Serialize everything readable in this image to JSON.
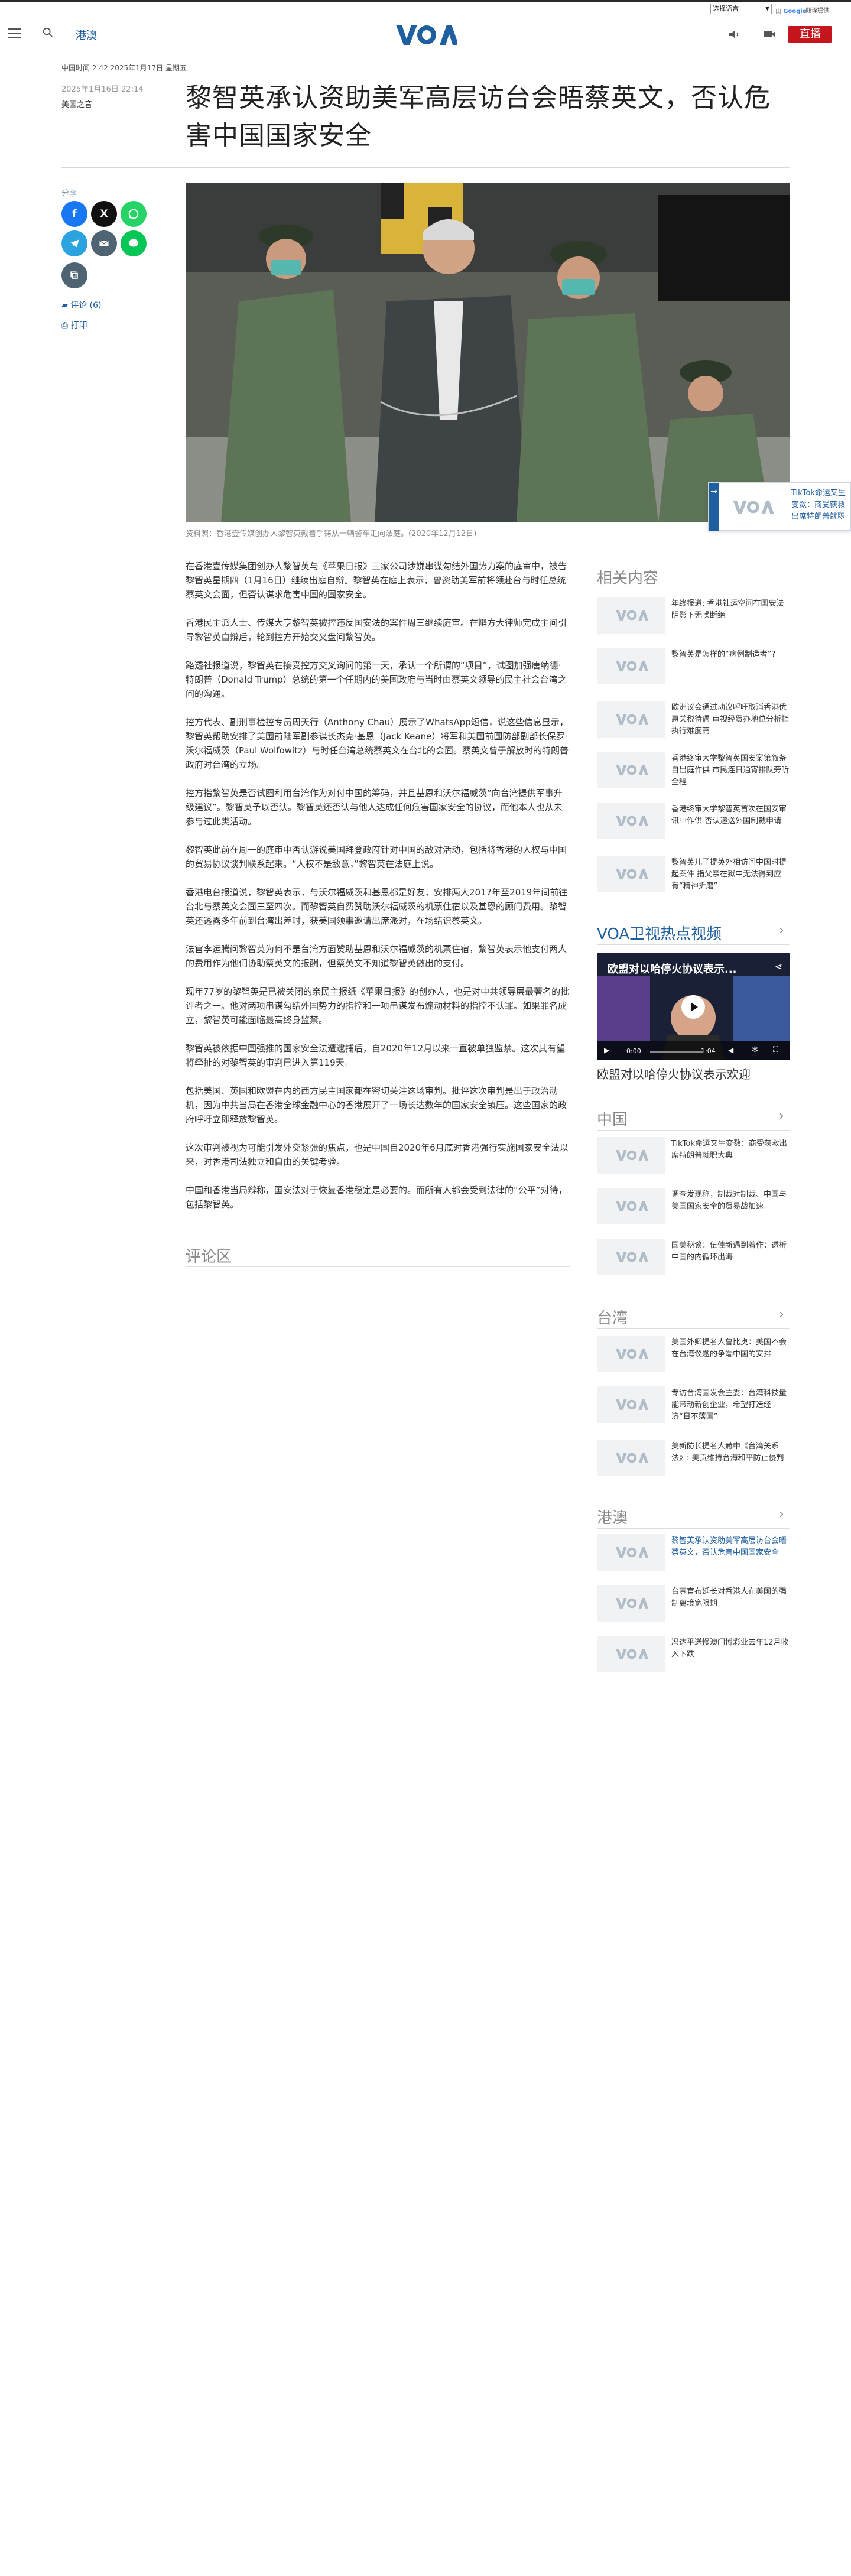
{
  "topbar": {
    "language_select": "选择语言",
    "google_badge": "Google",
    "translate_label": "翻译提供"
  },
  "header": {
    "section": "港澳",
    "live_label": "直播",
    "brand_color": "#1f5f9f",
    "live_color": "#c4161c"
  },
  "article": {
    "dateline": "中国时间 2:42 2025年1月17日 星期五",
    "date": "2025年1月16日 22:14",
    "author": "美国之音",
    "title": "黎智英承认资助美军高层访台会晤蔡英文，否认危害中国国家安全",
    "share_label": "分享",
    "comment_link": "评论 (6)",
    "print_link": "打印",
    "caption": "资料照：香港壹传媒创办人黎智英戴着手铐从一辆警车走向法庭。(2020年12月12日)",
    "paragraphs": [
      "在香港壹传媒集团创办人黎智英与《苹果日报》三家公司涉嫌串谋勾结外国势力案的庭审中，被告黎智英星期四（1月16日）继续出庭自辩。黎智英在庭上表示，曾资助美军前将领赴台与时任总统蔡英文会面，但否认谋求危害中国的国家安全。",
      "香港民主派人士、传媒大亨黎智英被控违反国安法的案件周三继续庭审。在辩方大律师完成主问引导黎智英自辩后，轮到控方开始交叉盘问黎智英。",
      "路透社报道说，黎智英在接受控方交叉询问的第一天，承认一个所谓的“项目”，试图加强唐纳德·特朗普（Donald Trump）总统的第一个任期内的美国政府与当时由蔡英文领导的民主社会台湾之间的沟通。",
      "控方代表、副刑事检控专员周天行（Anthony Chau）展示了WhatsApp短信，说这些信息显示，黎智英帮助安排了美国前陆军副参谋长杰克·基恩（Jack Keane）将军和美国前国防部副部长保罗·沃尔福威茨（Paul Wolfowitz）与时任台湾总统蔡英文在台北的会面。蔡英文曾于解放时的特朗普政府对台湾的立场。",
      "控方指黎智英是否试图利用台湾作为对付中国的筹码，并且基恩和沃尔福威茨“向台湾提供军事升级建议”。黎智英予以否认。黎智英还否认与他人达成任何危害国家安全的协议，而他本人也从未参与过此类活动。",
      "黎智英此前在周一的庭审中否认游说美国拜登政府针对中国的敌对活动，包括将香港的人权与中国的贸易协议谈判联系起来。“人权不是敌意，”黎智英在法庭上说。",
      "香港电台报道说，黎智英表示，与沃尔福威茨和基恩都是好友，安排两人2017年至2019年间前往台北与蔡英文会面三至四次。而黎智英自费赞助沃尔福威茨的机票住宿以及基恩的顾问费用。黎智英还透露多年前到台湾出差时，获美国领事邀请出席派对，在场结识蔡英文。",
      "法官李运腾问黎智英为何不是台湾方面赞助基恩和沃尔福威茨的机票住宿，黎智英表示他支付两人的费用作为他们协助蔡英文的报酬，但蔡英文不知道黎智英做出的支付。",
      "现年77岁的黎智英是已被关闭的亲民主报纸《苹果日报》的创办人，也是对中共领导层最著名的批评者之一。他对两项串谋勾结外国势力的指控和一项串谋发布煽动材料的指控不认罪。如果罪名成立，黎智英可能面临最高终身监禁。",
      "黎智英被依据中国强推的国家安全法遭逮捕后，自2020年12月以来一直被单独监禁。这次其有望将牵扯的对黎智英的审判已进入第119天。",
      "包括美国、英国和欧盟在内的西方民主国家都在密切关注这场审判。批评这次审判是出于政治动机，因为中共当局在香港全球金融中心的香港展开了一场长达数年的国家安全镇压。这些国家的政府呼吁立即释放黎智英。",
      "这次审判被视为可能引发外交紧张的焦点，也是中国自2020年6月底对香港强行实施国家安全法以来，对香港司法独立和自由的关键考验。",
      "中国和香港当局辩称，国安法对于恢复香港稳定是必要的。而所有人都会受到法律的“公平”对待，包括黎智英。"
    ],
    "comments_title": "评论区"
  },
  "sidebar": {
    "related_title": "相关内容",
    "related": [
      "年终报道: 香港社运空间在国安法阴影下无噪断绝",
      "黎智英是怎样的“病例制造者”?",
      "欧洲议会通过动议呼吁取消香港优惠关税待遇 审视经贸办地位分析指执行难度高",
      "香港终审大学黎智英国安案第叙条自出庭作供 市民连日通宵排队旁听全程",
      "香港终审大学黎智英首次在国安审讯中作供 否认递送外国制裁申请",
      "黎智英儿子提英外相访问中国时提起案件 指父亲在狱中无法得到应有“精神折磨”"
    ],
    "video_section_title": "VOA卫视热点视频",
    "video": {
      "overlay_title": "欧盟对以哈停火协议表示...",
      "current_time": "0:00",
      "duration": "1:04",
      "caption": "欧盟对以哈停火协议表示欢迎"
    },
    "china_title": "中国",
    "china": [
      "TikTok命运又生变数：商受获救出席特朗普就职大典",
      "调查发现称，制裁对制裁、中国与美国国家安全的贸易战加速",
      "国美秘谈：伍佳新遇到着作：透析中国的内循环出海"
    ],
    "taiwan_title": "台湾",
    "taiwan": [
      "美国外卿提名人鲁比奥：美国不会在台湾议题的争端中国的安排",
      "专访台湾国发会主委：台湾科技量能带动新创企业，希望打造经济“日不落国”",
      "美新防长提名人赫申《台湾关系法》: 美贡维持台海和平防止侵判"
    ],
    "hk_title": "港澳",
    "hk": [
      "黎智英承认资助美军高层访台会晤蔡英文，否认危害中国国家安全",
      "台壹官布延长对香港人在美国的强制离境宽限期",
      "冯达平送慢澳门博彩业去年12月收入下跌"
    ]
  },
  "floater": {
    "text": "TikTok命运又生变数：商受获救出席特朗普就职"
  }
}
